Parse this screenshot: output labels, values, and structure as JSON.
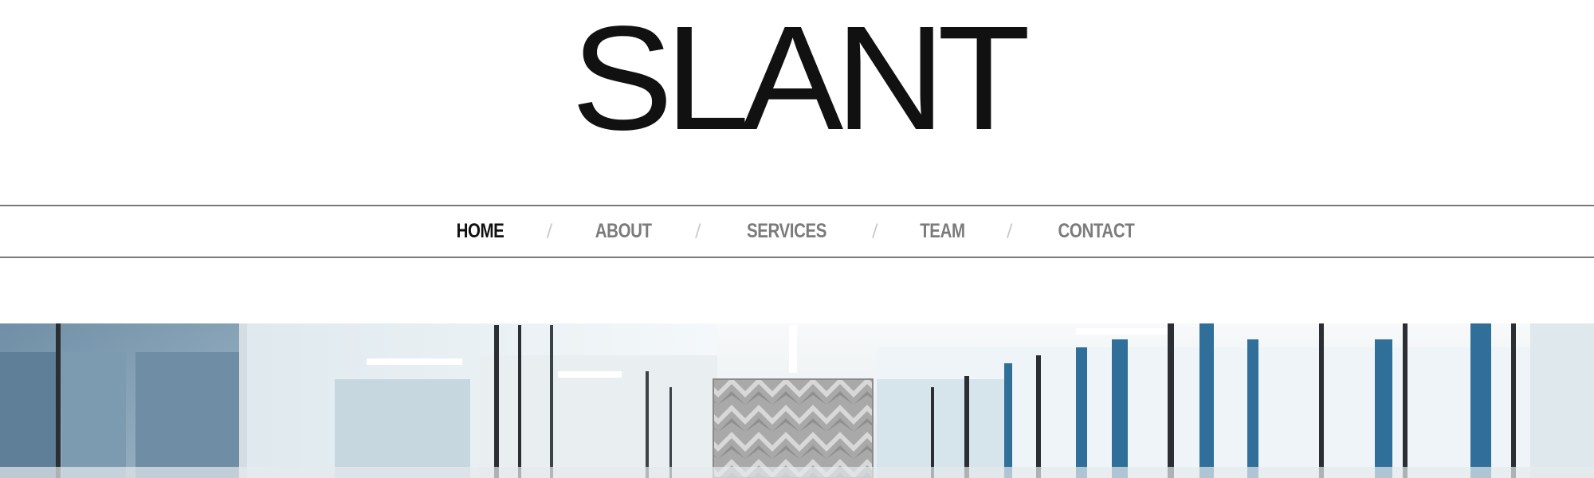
{
  "site": {
    "logo_text": "SLANT"
  },
  "nav": {
    "items": [
      {
        "label": "HOME",
        "active": true
      },
      {
        "label": "ABOUT",
        "active": false
      },
      {
        "label": "SERVICES",
        "active": false
      },
      {
        "label": "TEAM",
        "active": false
      },
      {
        "label": "CONTACT",
        "active": false
      }
    ],
    "separator": "/"
  },
  "hero": {
    "image_subject": "office-interior-glass-walls"
  },
  "colors": {
    "logo": "#111111",
    "nav_active": "#111111",
    "nav_inactive": "#7b7b7b",
    "nav_separator": "#c8c8c8",
    "rule": "#7a7a7a",
    "glass_blue": "#2f6f9a"
  }
}
